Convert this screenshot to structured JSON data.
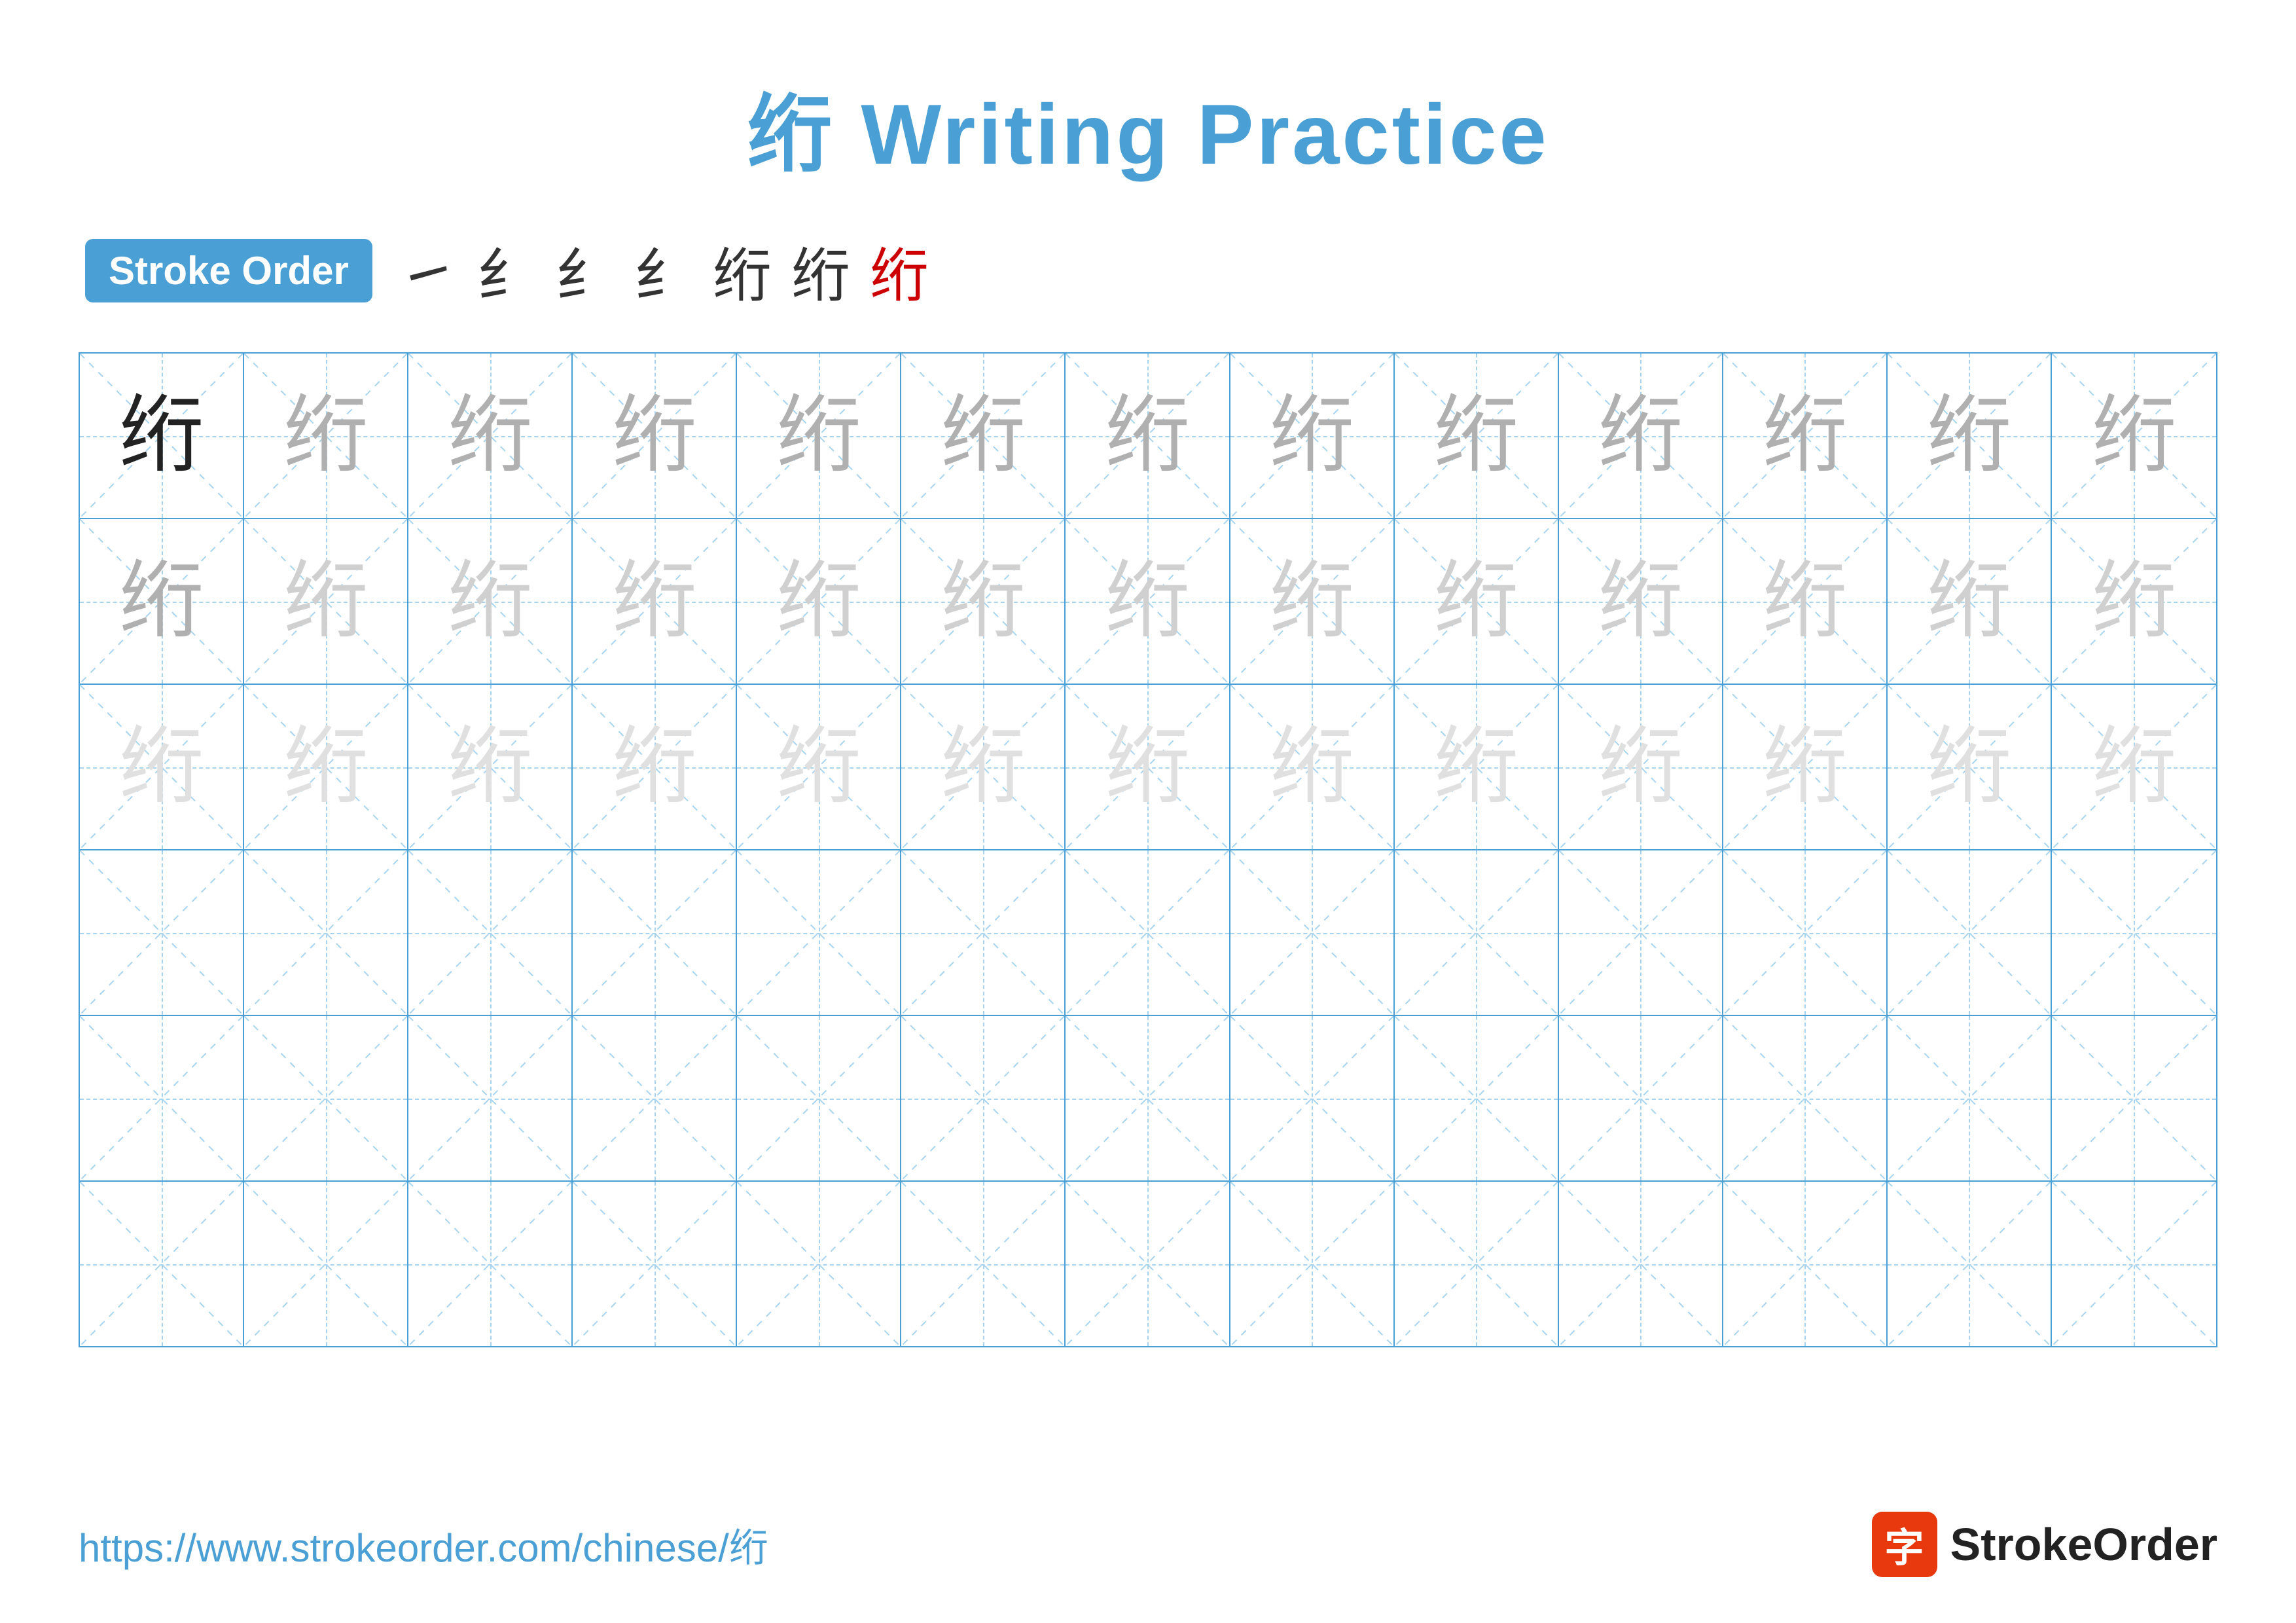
{
  "title": {
    "char": "绗",
    "suffix": " Writing Practice"
  },
  "stroke_order": {
    "badge_label": "Stroke Order",
    "strokes": [
      "㇀",
      "纟",
      "纟",
      "纟",
      "纟",
      "纟",
      "绗"
    ]
  },
  "grid": {
    "rows": 6,
    "cols": 13,
    "char": "绗",
    "row_styles": [
      "dark",
      "medium",
      "light",
      "empty",
      "empty",
      "empty"
    ]
  },
  "footer": {
    "url": "https://www.strokeorder.com/chinese/绗",
    "brand": "StrokeOrder"
  }
}
